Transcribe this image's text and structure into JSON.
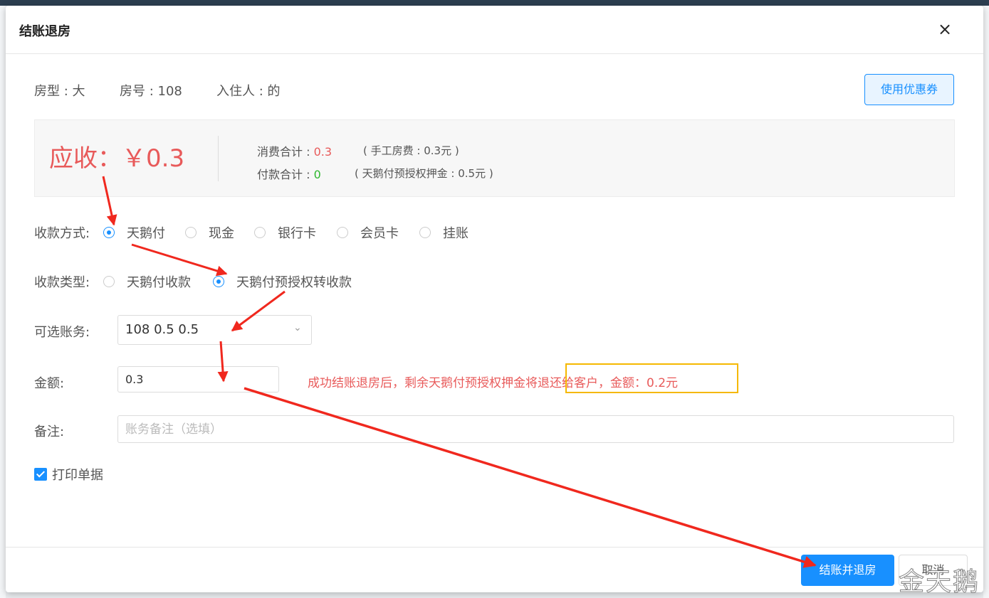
{
  "dialog": {
    "title": "结账退房",
    "close_label": "×"
  },
  "room_info": {
    "room_type": "房型 : 大",
    "room_number": "房号 : 108",
    "guest": "入住人 : 的"
  },
  "coupon_button": "使用优惠券",
  "summary": {
    "amount_due": "应收：￥0.3",
    "consumption_label": "消费合计 : ",
    "consumption_value": "0.3",
    "consumption_note": "( 手工房费 : 0.3元 )",
    "payment_label": "付款合计 : ",
    "payment_value": "0",
    "payment_note": "( 天鹅付预授权押金 : 0.5元 )"
  },
  "payment_method": {
    "label": "收款方式:",
    "options": [
      "天鹅付",
      "现金",
      "银行卡",
      "会员卡",
      "挂账"
    ],
    "selected": "天鹅付"
  },
  "payment_type": {
    "label": "收款类型:",
    "options": [
      "天鹅付收款",
      "天鹅付预授权转收款"
    ],
    "selected": "天鹅付预授权转收款"
  },
  "account": {
    "label": "可选账务:",
    "value": "108 0.5 0.5",
    "arrow": "chevron-down-icon"
  },
  "amount": {
    "label": "金额:",
    "value": "0.3",
    "hint": "成功结账退房后，剩余天鹅付预授权押金将退还给客户，金额：0.2元"
  },
  "remark": {
    "label": "备注:",
    "placeholder": "账务备注（选填）"
  },
  "print_receipt": {
    "label": "打印单据",
    "checked": true
  },
  "footer": {
    "confirm_label": "结账并退房",
    "cancel_label": "取消"
  },
  "watermark": "金天鹅",
  "colors": {
    "primary": "#1890ff",
    "danger": "#e85a5a",
    "success": "#2eb82e",
    "highlight": "#f5b800",
    "annotation_arrow": "#f0281e"
  }
}
